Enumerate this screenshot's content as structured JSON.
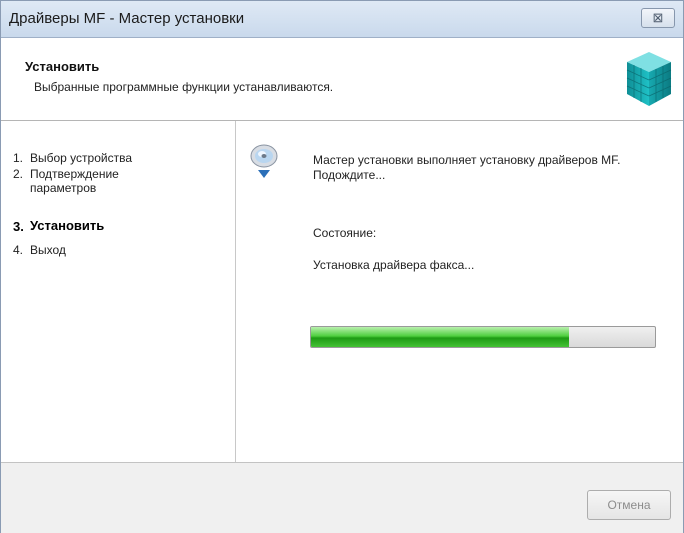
{
  "window": {
    "title": "Драйверы MF - Мастер установки",
    "close_glyph": "⊠"
  },
  "header": {
    "title": "Установить",
    "subtitle": "Выбранные программные функции устанавливаются.",
    "logo_icon": "installer-cube-icon"
  },
  "steps": [
    {
      "num": "1.",
      "label": "Выбор устройства",
      "active": false
    },
    {
      "num": "2.",
      "label": "Подтверждение параметров",
      "active": false
    },
    {
      "num": "3.",
      "label": "Установить",
      "active": true
    },
    {
      "num": "4.",
      "label": "Выход",
      "active": false
    }
  ],
  "content": {
    "icon": "cd-install-icon",
    "message": "Мастер установки выполняет установку драйверов MF. Подождите...",
    "status_label": "Состояние:",
    "status_text": "Установка драйвера факса...",
    "progress_percent": 75
  },
  "footer": {
    "cancel_label": "Отмена",
    "cancel_enabled": false
  },
  "colors": {
    "titlebar": "#c9d9ec",
    "progress_fill": "#2fb12a",
    "logo": "#1aa3a8"
  }
}
